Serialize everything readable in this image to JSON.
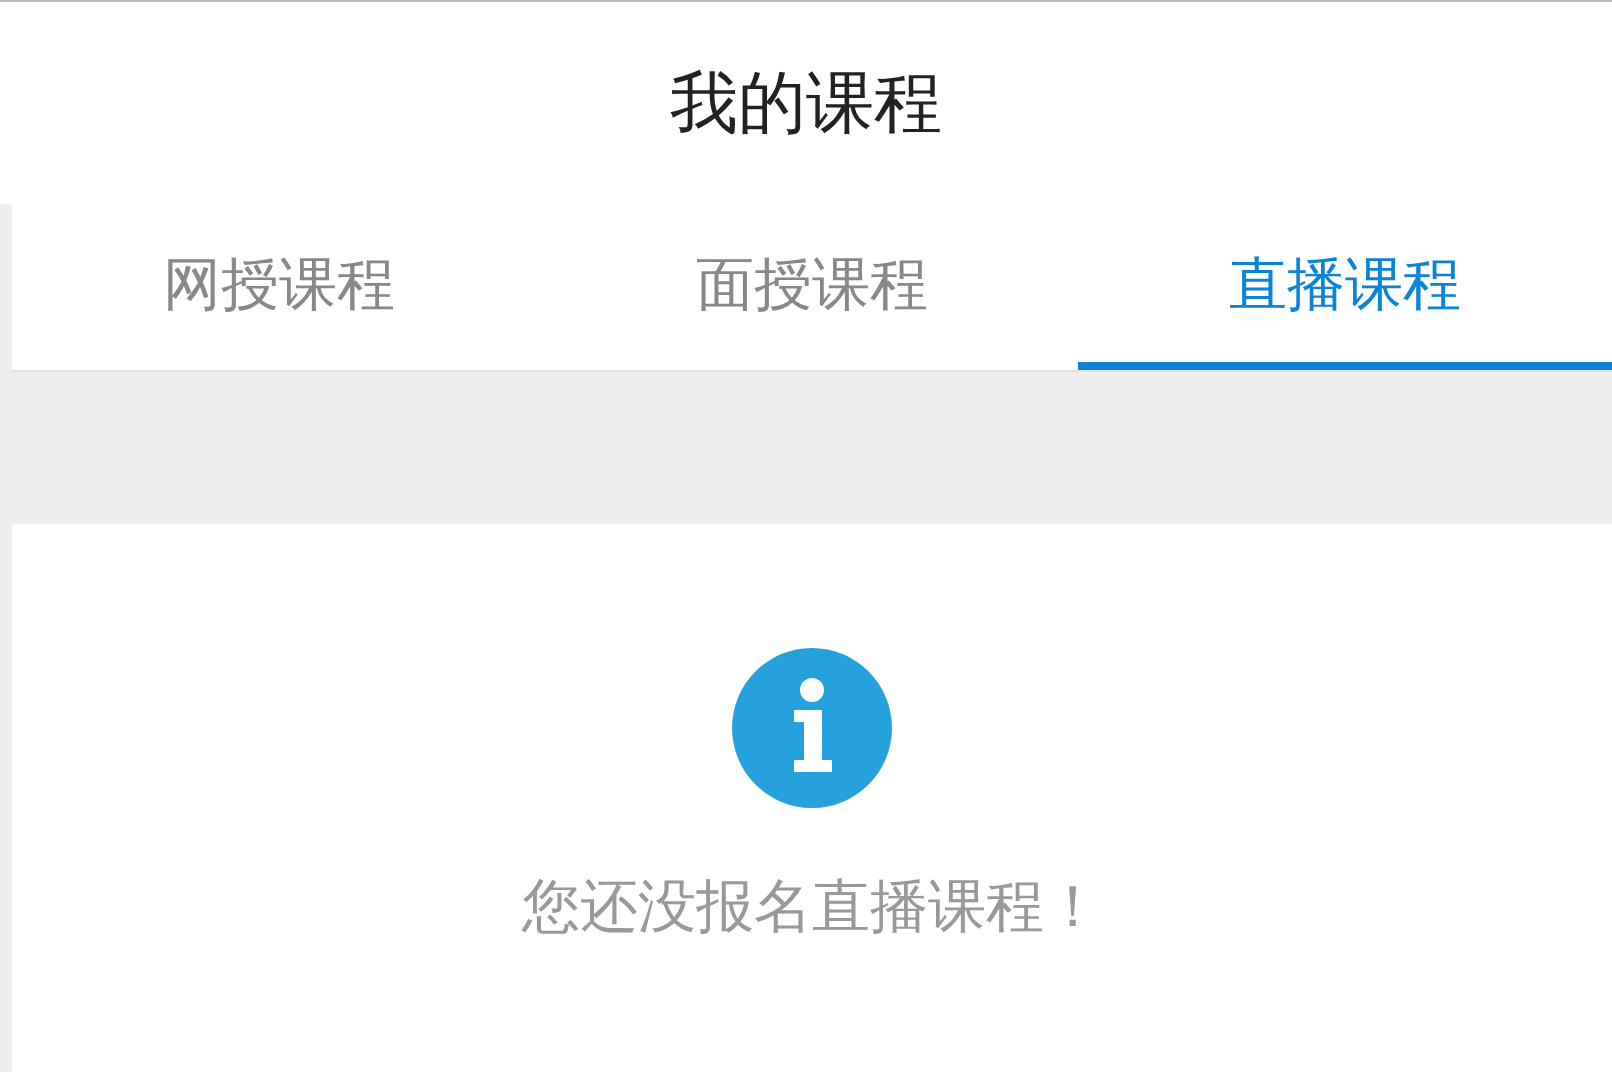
{
  "header": {
    "title": "我的课程"
  },
  "tabs": [
    {
      "label": "网授课程",
      "selected": false
    },
    {
      "label": "面授课程",
      "selected": false
    },
    {
      "label": "直播课程",
      "selected": true
    }
  ],
  "empty_state": {
    "message": "您还没报名直播课程！"
  }
}
